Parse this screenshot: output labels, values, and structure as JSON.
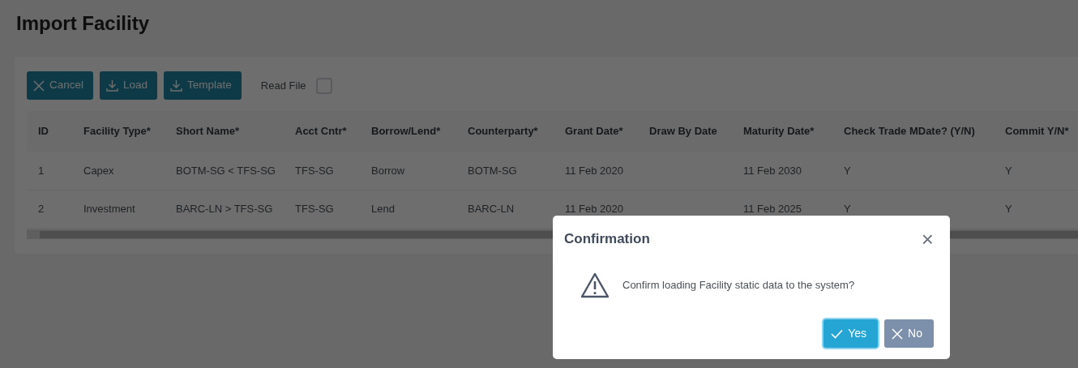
{
  "page": {
    "title": "Import Facility"
  },
  "toolbar": {
    "buttons": [
      {
        "label": "Cancel",
        "kind": "cancel"
      },
      {
        "label": "Load",
        "kind": "download"
      },
      {
        "label": "Template",
        "kind": "download"
      }
    ],
    "read_file": {
      "label": "Read File",
      "checked": false
    }
  },
  "table": {
    "columns": [
      "ID",
      "Facility Type*",
      "Short Name*",
      "Acct Cntr*",
      "Borrow/Lend*",
      "Counterparty*",
      "Grant Date*",
      "Draw By Date",
      "Maturity Date*",
      "Check Trade MDate? (Y/N)",
      "Commit Y/N*"
    ],
    "rows": [
      [
        "1",
        "Capex",
        "BOTM-SG < TFS-SG",
        "TFS-SG",
        "Borrow",
        "BOTM-SG",
        "11 Feb 2020",
        "",
        "11 Feb 2030",
        "Y",
        "Y"
      ],
      [
        "2",
        "Investment",
        "BARC-LN > TFS-SG",
        "TFS-SG",
        "Lend",
        "BARC-LN",
        "11 Feb 2020",
        "",
        "11 Feb 2025",
        "Y",
        "Y"
      ]
    ]
  },
  "dialog": {
    "title": "Confirmation",
    "close": "×",
    "message": "Confirm loading Facility static data to the system?",
    "buttons": [
      {
        "label": "Yes",
        "kind": "confirm",
        "focused": true
      },
      {
        "label": "No",
        "kind": "cancel",
        "focused": false
      }
    ]
  }
}
